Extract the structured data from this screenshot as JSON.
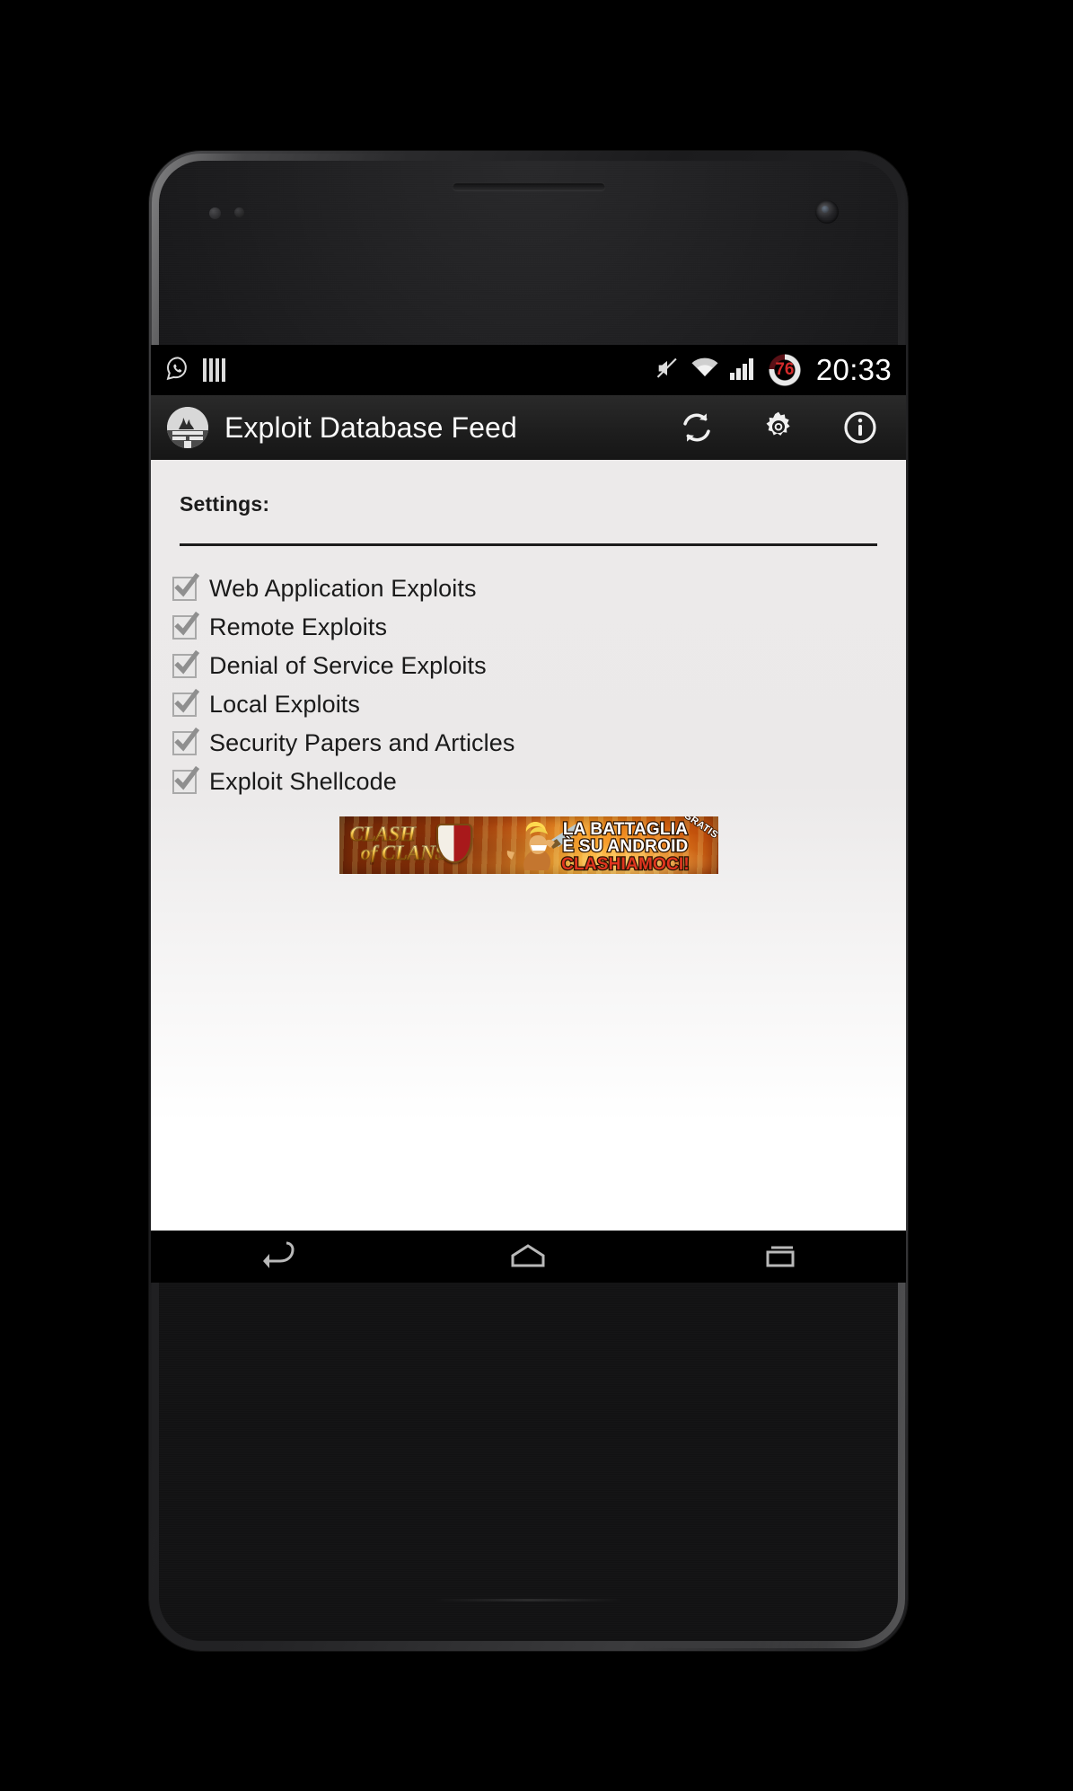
{
  "device": {
    "name": "android-phone",
    "speaker_icon": "speaker-grille",
    "camera_icon": "front-camera"
  },
  "statusbar": {
    "left_icons": [
      {
        "name": "whatsapp-notification-icon",
        "label": "WhatsApp"
      },
      {
        "name": "bars-notification-icon",
        "label": "Bars"
      }
    ],
    "right_icons": [
      {
        "name": "volume-muted-icon",
        "label": "Muted"
      },
      {
        "name": "wifi-icon",
        "label": "Wi-Fi"
      },
      {
        "name": "cellular-signal-icon",
        "label": "Signal"
      }
    ],
    "battery": {
      "name": "battery-indicator",
      "percent": "76",
      "color": "#d42b2b"
    },
    "clock": "20:33"
  },
  "actionbar": {
    "app_icon": "exploit-db-logo-icon",
    "title": "Exploit Database Feed",
    "actions": [
      {
        "name": "refresh-button",
        "icon": "refresh-icon",
        "label": "Refresh"
      },
      {
        "name": "settings-button",
        "icon": "gear-icon",
        "label": "Settings"
      },
      {
        "name": "info-button",
        "icon": "info-icon",
        "label": "Info"
      }
    ]
  },
  "main": {
    "section_title": "Settings:",
    "checkboxes": [
      {
        "label": "Web Application Exploits",
        "checked": true
      },
      {
        "label": "Remote Exploits",
        "checked": true
      },
      {
        "label": "Denial of Service Exploits",
        "checked": true
      },
      {
        "label": "Local Exploits",
        "checked": true
      },
      {
        "label": "Security Papers and Articles",
        "checked": true
      },
      {
        "label": "Exploit Shellcode",
        "checked": true
      }
    ]
  },
  "ad": {
    "name": "clash-of-clans-ad-banner",
    "logo_line1": "CLASH",
    "logo_line2": "of CLANS",
    "copy_line1": "LA BATTAGLIA",
    "copy_line2": "È SU ANDROID",
    "copy_line3": "CLASHIAMOCI!",
    "badge": "GRATIS",
    "brand_color": "#e46b10"
  },
  "navbar": {
    "buttons": [
      {
        "name": "nav-back-button",
        "icon": "back-arrow-icon",
        "label": "Back"
      },
      {
        "name": "nav-home-button",
        "icon": "home-icon",
        "label": "Home"
      },
      {
        "name": "nav-recents-button",
        "icon": "recents-icon",
        "label": "Recents"
      }
    ]
  }
}
